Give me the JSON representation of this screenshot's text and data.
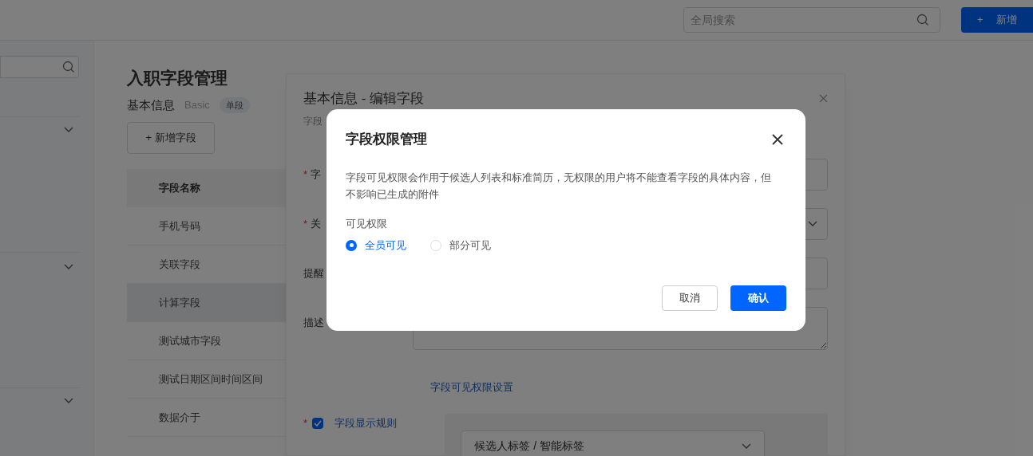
{
  "topbar": {
    "search": {
      "placeholder": "全局搜索"
    },
    "new_button": {
      "icon": "+",
      "label": "新增"
    }
  },
  "sidebar": {
    "sections": [
      {
        "expanded": false
      },
      {
        "expanded": false
      },
      {
        "expanded": false
      }
    ]
  },
  "page": {
    "title": "入职字段管理",
    "section": {
      "title": "基本信息",
      "subtitle": "Basic",
      "badge": "单段"
    },
    "add_button": "+ 新增字段",
    "table": {
      "columns": [
        "字段名称"
      ],
      "rows": [
        {
          "name": "手机号码",
          "selected": false
        },
        {
          "name": "关联字段",
          "selected": false
        },
        {
          "name": "计算字段",
          "selected": true
        },
        {
          "name": "测试城市字段",
          "selected": false
        },
        {
          "name": "测试日期区间时间区间",
          "selected": false
        },
        {
          "name": "数据介于",
          "selected": false
        }
      ]
    }
  },
  "drawer": {
    "title": "基本信息 - 编辑字段",
    "subtitle": "字段",
    "fields": [
      {
        "label": "字",
        "required_mark": "*",
        "kind": "input"
      },
      {
        "label": "关",
        "required_mark": "*",
        "kind": "select"
      },
      {
        "label": "提醒",
        "kind": "input"
      },
      {
        "label": "描述",
        "kind": "textarea"
      }
    ],
    "permission_link": "字段可见权限设置",
    "display_rule": {
      "label": "字段显示规则",
      "required_mark": "*",
      "checked": true
    },
    "rule_select": {
      "value": "候选人标签 / 智能标签"
    }
  },
  "modal": {
    "title": "字段权限管理",
    "description": "字段可见权限会作用于候选人列表和标准简历，无权限的用户将不能查看字段的具体内容，但不影响已生成的附件",
    "visibility": {
      "label": "可见权限",
      "options": [
        {
          "label": "全员可见",
          "selected": true
        },
        {
          "label": "部分可见",
          "selected": false
        }
      ]
    },
    "buttons": [
      {
        "label": "取消",
        "kind": "secondary"
      },
      {
        "label": "确认",
        "kind": "primary"
      }
    ]
  }
}
